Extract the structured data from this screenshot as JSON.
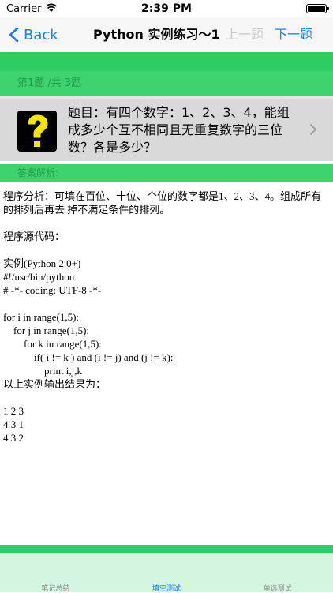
{
  "status": {
    "carrier": "Carrier",
    "time": "2:39 PM"
  },
  "nav": {
    "back_label": "Back",
    "title": "Python 实例练习～1",
    "prev_label": "上一题",
    "next_label": "下一题"
  },
  "info": {
    "progress": "第1题 /共 3题"
  },
  "question": {
    "icon": "question-mark-icon",
    "text": "题目：有四个数字：1、2、3、4，能组成多少个互不相同且无重复数字的三位数？各是多少？"
  },
  "answer": {
    "label": "答案解析:"
  },
  "content": {
    "analysis": "程序分析：可填在百位、十位、个位的数字都是1、2、3、4。组成所有的排列后再去 掉不满足条件的排列。",
    "source_heading": "程序源代码：",
    "code": [
      "实例(Python 2.0+)",
      "#!/usr/bin/python",
      "# -*- coding: UTF-8 -*-",
      "",
      "for i in range(1,5):",
      "    for j in range(1,5):",
      "        for k in range(1,5):",
      "            if( i != k ) and (i != j) and (j != k):",
      "                print i,j,k",
      "以上实例输出结果为：",
      "",
      "1 2 3",
      "4 3 1",
      "4 3 2"
    ]
  },
  "tabs": [
    {
      "label": "笔记总结"
    },
    {
      "label": "填空测试"
    },
    {
      "label": "单选测试"
    }
  ],
  "colors": {
    "accent": "#1a7cf6",
    "green": "#2fcc63"
  }
}
